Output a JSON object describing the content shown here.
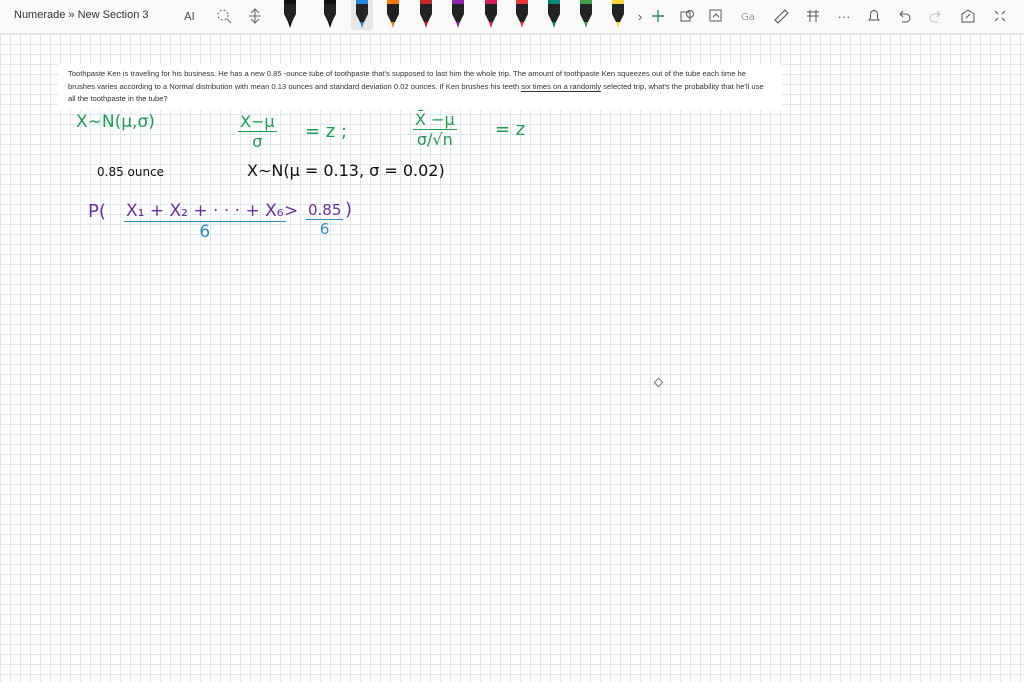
{
  "breadcrumb": "Numerade » New Section 3",
  "toolbar": {
    "icons": [
      "text-cursor-icon",
      "lasso-icon",
      "insert-space-icon",
      "undo-icon",
      "redo-icon",
      "share-icon",
      "fullscreen-icon"
    ],
    "more_label": "···",
    "pens": [
      {
        "color": "#111111"
      },
      {
        "color": "#111111"
      },
      {
        "color": "#1e88e5",
        "selected": true
      },
      {
        "color": "#f57c00"
      },
      {
        "color": "#c62828"
      },
      {
        "color": "#8e24aa"
      },
      {
        "color": "#d81b60"
      },
      {
        "color": "#e53935"
      },
      {
        "color": "#00897b"
      },
      {
        "color": "#43a047"
      },
      {
        "color": "#fdd835"
      },
      {
        "color": "#5e35b1"
      },
      {
        "color": "#00acc1"
      }
    ],
    "accent": "#ff8c00"
  },
  "question": {
    "text_before": "Toothpaste Ken is traveling for his business. He has a new 0.85 -ounce tube of toothpaste that's supposed to last him the whole trip. The amount of toothpaste Ken squeezes out of the tube each time he brushes varies according to a Normal distribution with mean 0.13 ounces and standard deviation 0.02 ounces. If Ken brushes his teeth ",
    "underlined": "six times on a randomly",
    "text_after": " selected trip, what's the probability that he'll use all the toothpaste in the tube?"
  },
  "handwriting": {
    "line1a": "X∼N(μ,σ)",
    "line1b_num": "X−μ",
    "line1b_den": "σ",
    "line1b_eq": "= z ;",
    "line1c_num": "X̄ −μ",
    "line1c_den": "σ/√n",
    "line1c_eq": "= z",
    "line2a": "0.85 ounce",
    "line2b": "X∼N(μ = 0.13, σ = 0.02)",
    "line3_open": "P(",
    "line3_num": "X₁ + X₂ + · · · + X₆",
    "line3_den": "6",
    "line3_gt": ">",
    "line3_rnum": "0.85",
    "line3_rden": "6",
    "line3_close": ")"
  }
}
